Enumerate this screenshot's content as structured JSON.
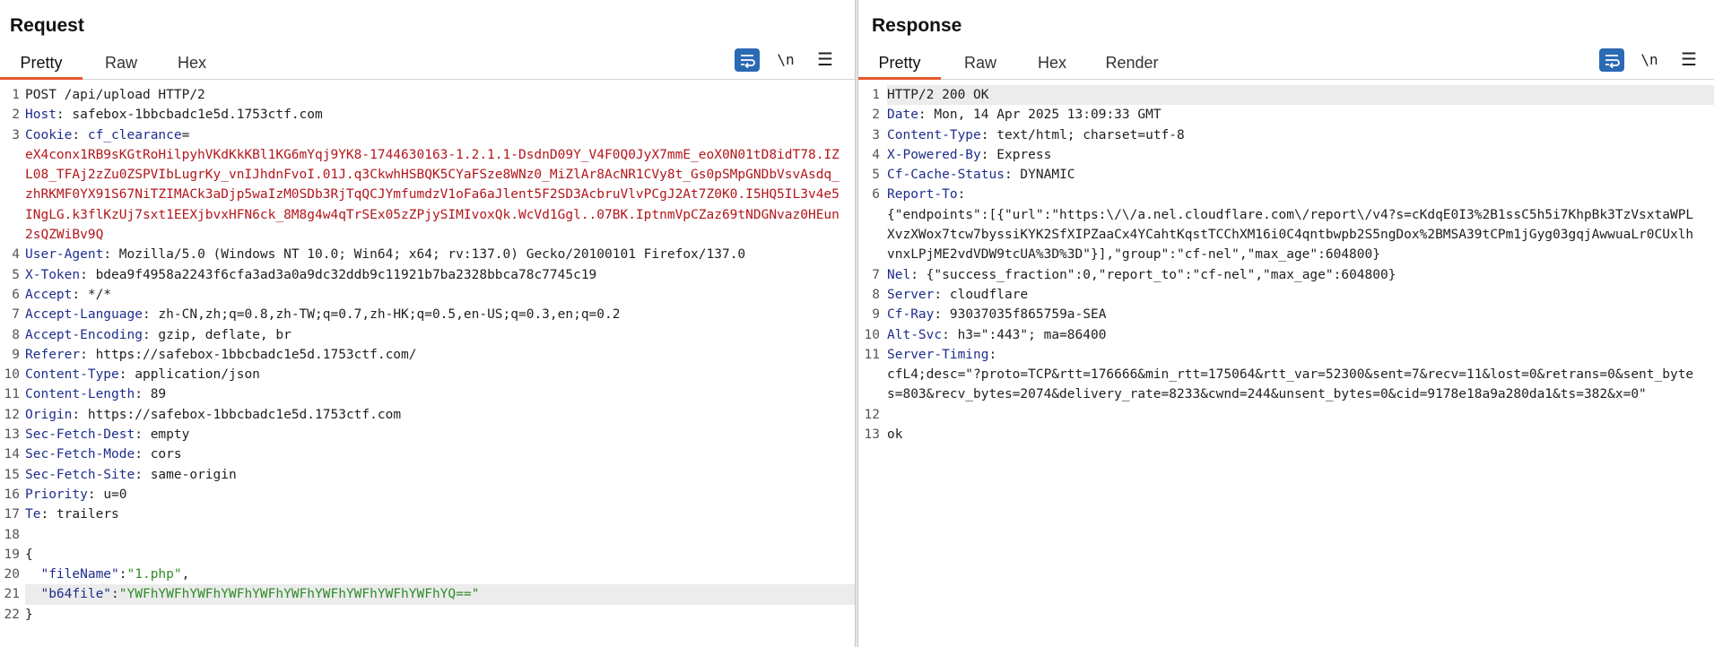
{
  "request": {
    "title": "Request",
    "tabs": [
      "Pretty",
      "Raw",
      "Hex"
    ],
    "active_tab": "Pretty",
    "newline_label": "\\n",
    "lines": [
      {
        "n": "1",
        "plain": "POST /api/upload HTTP/2"
      },
      {
        "n": "2",
        "name": "Host",
        "value": "safebox-1bbcbadc1e5d.1753ctf.com"
      },
      {
        "n": "3",
        "name": "Cookie",
        "cookie_name": "cf_clearance",
        "cookie_eq": "=",
        "cookie_value": "eX4conx1RB9sKGtRoHilpyhVKdKkKBl1KG6mYqj9YK8-1744630163-1.2.1.1-DsdnD09Y_V4F0Q0JyX7mmE_eoX0N01tD8idT78.IZL08_TFAj2zZu0ZSPVIbLugrKy_vnIJhdnFvoI.01J.q3CkwhHSBQK5CYaFSze8WNz0_MiZlAr8AcNR1CVy8t_Gs0pSMpGNDbVsvAsdq_zhRKMF0YX91S67NiTZIMACk3aDjp5waIzM0SDb3RjTqQCJYmfumdzV1oFa6aJlent5F2SD3AcbruVlvPCgJ2At7Z0K0.I5HQ5IL3v4e5INgLG.k3flKzUj7sxt1EEXjbvxHFN6ck_8M8g4w4qTrSEx05zZPjySIMIvoxQk.WcVd1Ggl..07BK.IptnmVpCZaz69tNDGNvaz0HEun2sQZWiBv9Q"
      },
      {
        "n": "4",
        "name": "User-Agent",
        "value": "Mozilla/5.0 (Windows NT 10.0; Win64; x64; rv:137.0) Gecko/20100101 Firefox/137.0"
      },
      {
        "n": "5",
        "name": "X-Token",
        "value": "bdea9f4958a2243f6cfa3ad3a0a9dc32ddb9c11921b7ba2328bbca78c7745c19"
      },
      {
        "n": "6",
        "name": "Accept",
        "value": "*/*"
      },
      {
        "n": "7",
        "name": "Accept-Language",
        "value": "zh-CN,zh;q=0.8,zh-TW;q=0.7,zh-HK;q=0.5,en-US;q=0.3,en;q=0.2"
      },
      {
        "n": "8",
        "name": "Accept-Encoding",
        "value": "gzip, deflate, br"
      },
      {
        "n": "9",
        "name": "Referer",
        "value": "https://safebox-1bbcbadc1e5d.1753ctf.com/"
      },
      {
        "n": "10",
        "name": "Content-Type",
        "value": "application/json"
      },
      {
        "n": "11",
        "name": "Content-Length",
        "value": "89"
      },
      {
        "n": "12",
        "name": "Origin",
        "value": "https://safebox-1bbcbadc1e5d.1753ctf.com"
      },
      {
        "n": "13",
        "name": "Sec-Fetch-Dest",
        "value": "empty"
      },
      {
        "n": "14",
        "name": "Sec-Fetch-Mode",
        "value": "cors"
      },
      {
        "n": "15",
        "name": "Sec-Fetch-Site",
        "value": "same-origin"
      },
      {
        "n": "16",
        "name": "Priority",
        "value": "u=0"
      },
      {
        "n": "17",
        "name": "Te",
        "value": "trailers"
      },
      {
        "n": "18",
        "plain": ""
      },
      {
        "n": "19",
        "plain": "{"
      },
      {
        "n": "20",
        "jkey": "\"fileName\"",
        "jsep": ":",
        "jval": "\"1.php\"",
        "jtail": ","
      },
      {
        "n": "21",
        "jkey": "\"b64file\"",
        "jsep": ":",
        "jval": "\"YWFhYWFhYWFhYWFhYWFhYWFhYWFhYWFhYWFhYWFhYQ==\"",
        "jtail": "",
        "highlight": true
      },
      {
        "n": "22",
        "plain": "}"
      }
    ]
  },
  "response": {
    "title": "Response",
    "tabs": [
      "Pretty",
      "Raw",
      "Hex",
      "Render"
    ],
    "active_tab": "Pretty",
    "newline_label": "\\n",
    "lines": [
      {
        "n": "1",
        "plain": "HTTP/2 200 OK",
        "highlight": true
      },
      {
        "n": "2",
        "name": "Date",
        "value": "Mon, 14 Apr 2025 13:09:33 GMT"
      },
      {
        "n": "3",
        "name": "Content-Type",
        "value": "text/html; charset=utf-8"
      },
      {
        "n": "4",
        "name": "X-Powered-By",
        "value": "Express"
      },
      {
        "n": "5",
        "name": "Cf-Cache-Status",
        "value": "DYNAMIC"
      },
      {
        "n": "6",
        "name": "Report-To",
        "value": "",
        "cont": "{\"endpoints\":[{\"url\":\"https:\\/\\/a.nel.cloudflare.com\\/report\\/v4?s=cKdqE0I3%2B1ssC5h5i7KhpBk3TzVsxtaWPLXvzXWox7tcw7byssiKYK2SfXIPZaaCx4YCahtKqstTCChXM16i0C4qntbwpb2S5ngDox%2BMSA39tCPm1jGyg03gqjAwwuaLr0CUxlhvnxLPjME2vdVDW9tcUA%3D%3D\"}],\"group\":\"cf-nel\",\"max_age\":604800}"
      },
      {
        "n": "7",
        "name": "Nel",
        "value": "{\"success_fraction\":0,\"report_to\":\"cf-nel\",\"max_age\":604800}"
      },
      {
        "n": "8",
        "name": "Server",
        "value": "cloudflare"
      },
      {
        "n": "9",
        "name": "Cf-Ray",
        "value": "93037035f865759a-SEA"
      },
      {
        "n": "10",
        "name": "Alt-Svc",
        "value": "h3=\":443\"; ma=86400"
      },
      {
        "n": "11",
        "name": "Server-Timing",
        "value": "",
        "cont": "cfL4;desc=\"?proto=TCP&rtt=176666&min_rtt=175064&rtt_var=52300&sent=7&recv=11&lost=0&retrans=0&sent_bytes=803&recv_bytes=2074&delivery_rate=8233&cwnd=244&unsent_bytes=0&cid=9178e18a9a280da1&ts=382&x=0\""
      },
      {
        "n": "12",
        "plain": ""
      },
      {
        "n": "13",
        "plain": "ok"
      }
    ]
  },
  "colors": {
    "accent_tab": "#e8592d",
    "header_name": "#1e2d8c",
    "cookie_value": "#b3161b",
    "json_string": "#2e8b28",
    "tool_button": "#2b6ab5"
  }
}
